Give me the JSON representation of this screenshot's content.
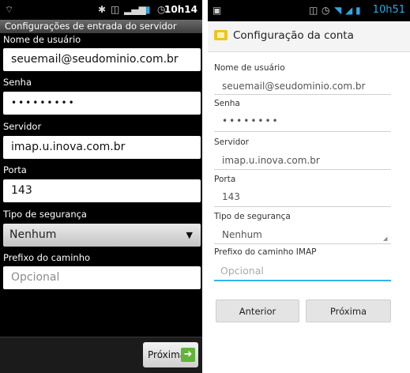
{
  "left": {
    "status_time": "10h14",
    "title": "Configurações de entrada do servidor",
    "username_label": "Nome de usuário",
    "username_value": "seuemail@seudominio.com.br",
    "password_label": "Senha",
    "password_value": "•••••••••",
    "server_label": "Servidor",
    "server_value": "imap.u.inova.com.br",
    "port_label": "Porta",
    "port_value": "143",
    "security_label": "Tipo de segurança",
    "security_value": "Nenhum",
    "path_label": "Prefixo do caminho",
    "path_placeholder": "Opcional",
    "next_label": "Próxima"
  },
  "right": {
    "status_time": "10h51",
    "title": "Configuração da conta",
    "username_label": "Nome de usuário",
    "username_value": "seuemail@seudominio.com.br",
    "password_label": "Senha",
    "password_value": "••••••••",
    "server_label": "Servidor",
    "server_value": "imap.u.inova.com.br",
    "port_label": "Porta",
    "port_value": "143",
    "security_label": "Tipo de segurança",
    "security_value": "Nenhum",
    "path_label": "Prefixo do caminho IMAP",
    "path_placeholder": "Opcional",
    "prev_label": "Anterior",
    "next_label": "Próxima"
  },
  "colors": {
    "accent_blue": "#33b5e5",
    "clock_blue": "#2aa9e0",
    "next_arrow_green": "#63b33b"
  }
}
